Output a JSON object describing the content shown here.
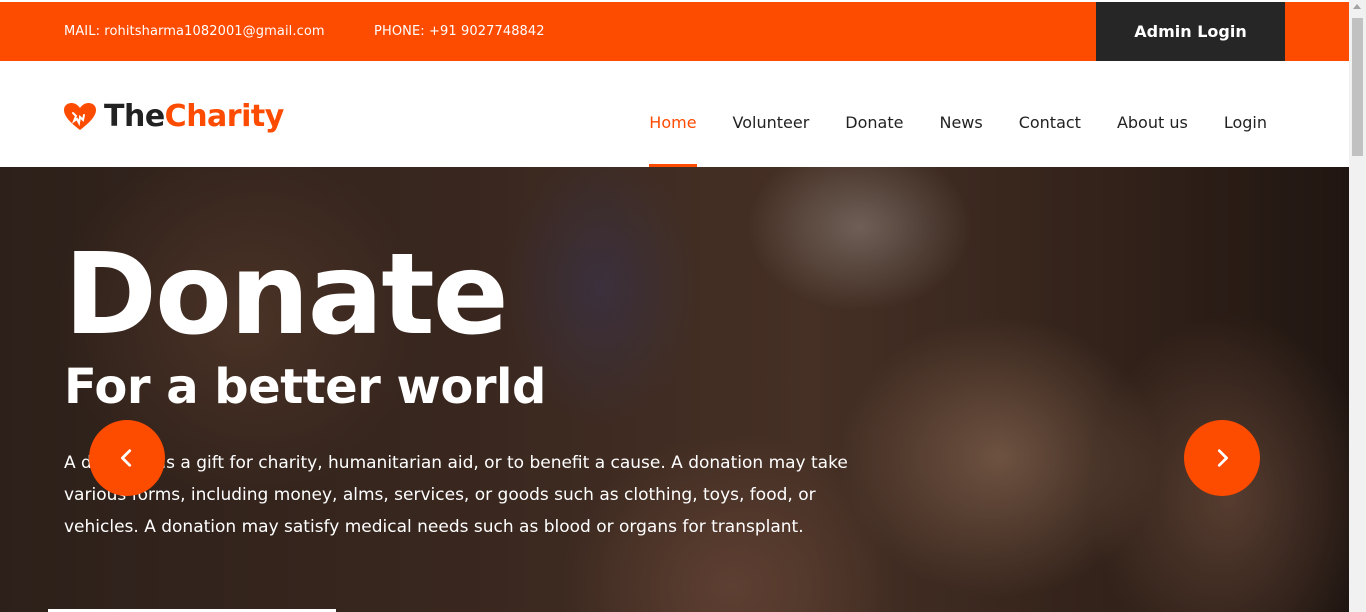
{
  "topbar": {
    "mail": "MAIL: rohitsharma1082001@gmail.com",
    "phone": "PHONE: +91 9027748842",
    "admin_login": "Admin Login"
  },
  "header": {
    "logo_the": "The",
    "logo_charity": "Charity",
    "nav": [
      {
        "label": "Home",
        "active": true
      },
      {
        "label": "Volunteer"
      },
      {
        "label": "Donate"
      },
      {
        "label": "News"
      },
      {
        "label": "Contact"
      },
      {
        "label": "About us"
      },
      {
        "label": "Login"
      }
    ]
  },
  "hero": {
    "title": "Donate",
    "subtitle": "For a better world",
    "text": "A donation is a gift for charity, humanitarian aid, or to benefit a cause. A donation may take various forms, including money, alms, services, or goods such as clothing, toys, food, or vehicles. A donation may satisfy medical needs such as blood or organs for transplant.",
    "prev_icon": "chevron-left-icon",
    "next_icon": "chevron-right-icon"
  },
  "colors": {
    "accent": "#fd4b00",
    "dark": "#262626"
  }
}
